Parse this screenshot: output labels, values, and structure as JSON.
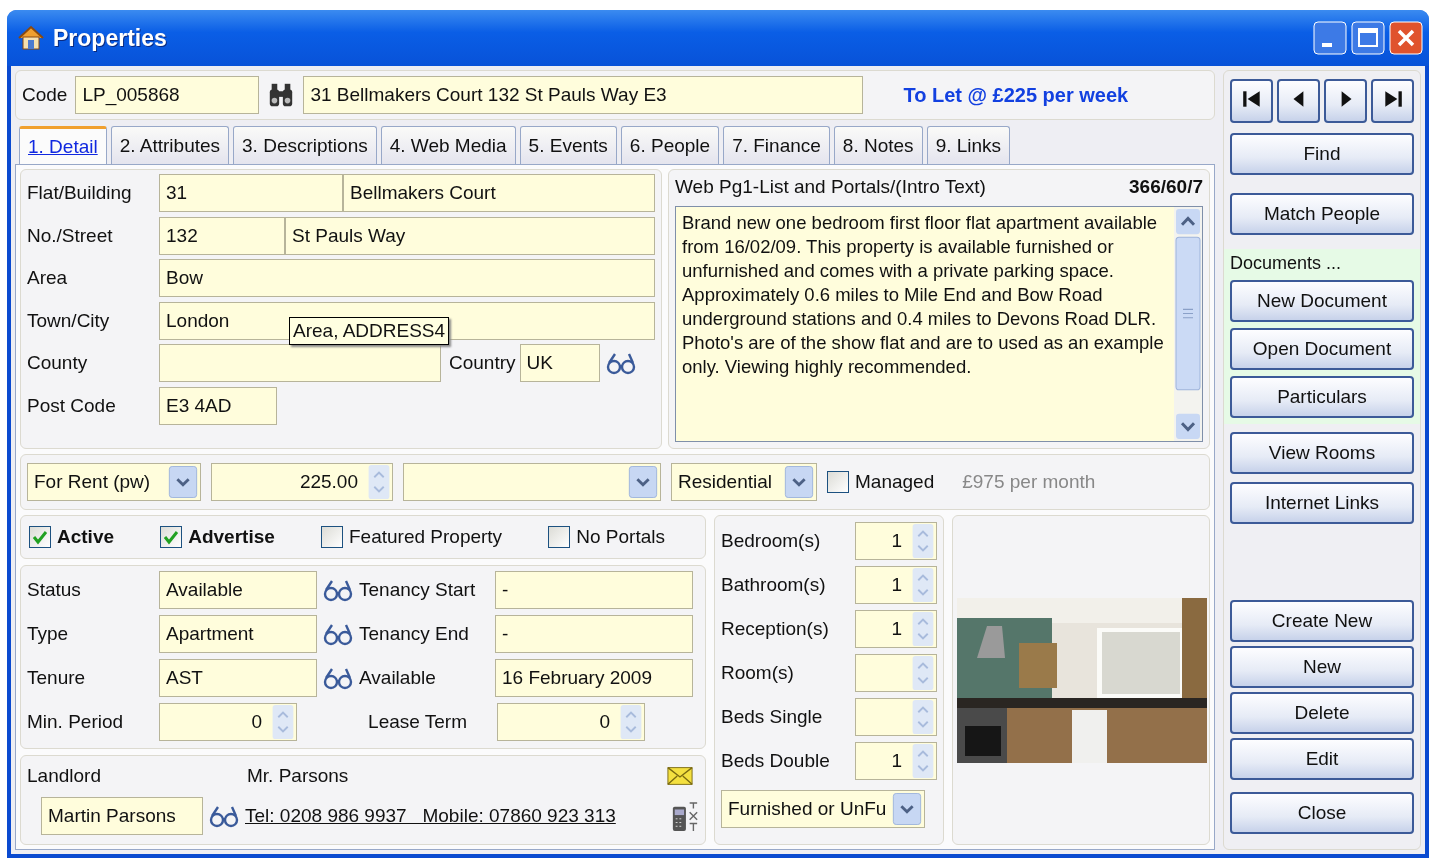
{
  "window": {
    "title": "Properties"
  },
  "header": {
    "code_label": "Code",
    "code": "LP_005868",
    "address": "31 Bellmakers Court 132 St Pauls Way E3",
    "status": "To Let @ £225 per week"
  },
  "tabs": [
    {
      "label": "1. Detail",
      "selected": true
    },
    {
      "label": "2. Attributes",
      "selected": false
    },
    {
      "label": "3. Descriptions",
      "selected": false
    },
    {
      "label": "4. Web Media",
      "selected": false
    },
    {
      "label": "5. Events",
      "selected": false
    },
    {
      "label": "6. People",
      "selected": false
    },
    {
      "label": "7. Finance",
      "selected": false
    },
    {
      "label": "8. Notes",
      "selected": false
    },
    {
      "label": "9. Links",
      "selected": false
    }
  ],
  "address": {
    "rows": [
      {
        "kind": "pair",
        "label": "Flat/Building",
        "values": [
          "31",
          "Bellmakers Court"
        ]
      },
      {
        "kind": "pair",
        "label": "No./Street",
        "values": [
          "132",
          "St Pauls Way"
        ]
      },
      {
        "kind": "single",
        "label": "Area",
        "values": [
          "Bow"
        ]
      },
      {
        "kind": "single",
        "label": "Town/City",
        "values": [
          "London"
        ]
      },
      {
        "kind": "county",
        "label": "County",
        "country_label": "Country",
        "country": "UK"
      },
      {
        "kind": "short",
        "label": "Post Code",
        "values": [
          "E3 4AD"
        ]
      }
    ],
    "tooltip": "Area, ADDRESS4"
  },
  "description": {
    "title": "Web Pg1-List and Portals/(Intro Text)",
    "counter": "366/60/7",
    "paragraphs": [
      "Brand new one bedroom first floor flat apartment available from 16/02/09. This property is available furnished or unfurnished and comes with a private parking space.",
      "Approximately 0.6 miles to Mile End and Bow Road underground stations and 0.4 miles to Devons Road DLR.",
      "Photo's are of the show flat and are to used as an example only. Viewing highly recommended."
    ]
  },
  "price": {
    "rent_type": "For Rent (pw)",
    "amount": "225.00",
    "category": "Residential",
    "managed": {
      "label": "Managed",
      "checked": false
    },
    "monthly": "£975 per month"
  },
  "flags": [
    {
      "label": "Active",
      "checked": true
    },
    {
      "label": "Advertise",
      "checked": true
    },
    {
      "label": "Featured Property",
      "checked": false
    },
    {
      "label": "No Portals",
      "checked": false
    }
  ],
  "tenancy": {
    "rows": [
      {
        "label": "Status",
        "value": "Available",
        "right_label": "Tenancy Start",
        "right_value": "-"
      },
      {
        "label": "Type",
        "value": "Apartment",
        "right_label": "Tenancy End",
        "right_value": "-"
      },
      {
        "label": "Tenure",
        "value": "AST",
        "right_label": "Available",
        "right_value": "16 February 2009"
      }
    ],
    "min_period": {
      "label": "Min. Period",
      "value": "0"
    },
    "lease_term": {
      "label": "Lease Term",
      "value": "0"
    }
  },
  "landlord": {
    "label": "Landlord",
    "salutation": "Mr. Parsons",
    "name": "Martin Parsons",
    "contact": "Tel: 0208 986 9937   Mobile: 07860 923 313"
  },
  "rooms": [
    {
      "label": "Bedroom(s)",
      "value": "1"
    },
    {
      "label": "Bathroom(s)",
      "value": "1"
    },
    {
      "label": "Reception(s)",
      "value": "1"
    },
    {
      "label": "Room(s)"
    },
    {
      "label": "Beds Single"
    },
    {
      "label": "Beds Double",
      "value": "1"
    }
  ],
  "furnishing": "Furnished or UnFu",
  "sidebar": {
    "find": "Find",
    "match": "Match People",
    "documents": {
      "label": "Documents ...",
      "buttons": [
        "New Document",
        "Open Document",
        "Particulars"
      ]
    },
    "room_buttons": [
      "View Rooms",
      "Internet Links"
    ],
    "record_buttons": [
      "Create New",
      "New",
      "Delete",
      "Edit",
      "Close"
    ]
  }
}
